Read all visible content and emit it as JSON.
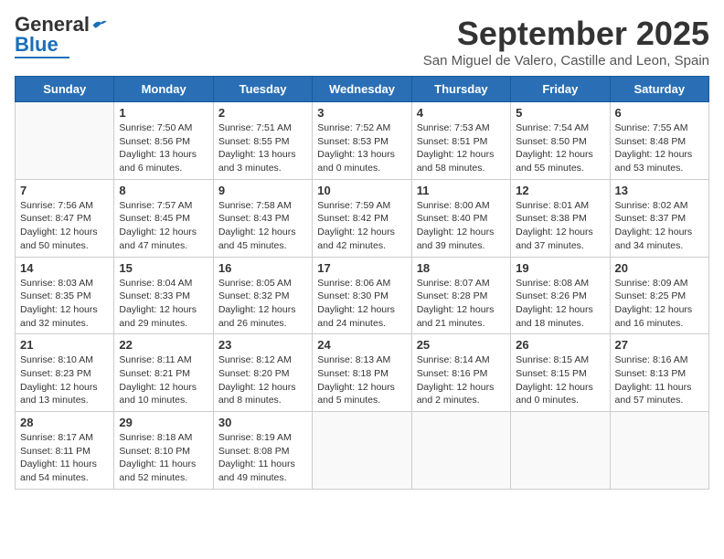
{
  "logo": {
    "general": "General",
    "blue": "Blue"
  },
  "title": "September 2025",
  "subtitle": "San Miguel de Valero, Castille and Leon, Spain",
  "weekdays": [
    "Sunday",
    "Monday",
    "Tuesday",
    "Wednesday",
    "Thursday",
    "Friday",
    "Saturday"
  ],
  "weeks": [
    [
      {
        "day": "",
        "info": ""
      },
      {
        "day": "1",
        "info": "Sunrise: 7:50 AM\nSunset: 8:56 PM\nDaylight: 13 hours\nand 6 minutes."
      },
      {
        "day": "2",
        "info": "Sunrise: 7:51 AM\nSunset: 8:55 PM\nDaylight: 13 hours\nand 3 minutes."
      },
      {
        "day": "3",
        "info": "Sunrise: 7:52 AM\nSunset: 8:53 PM\nDaylight: 13 hours\nand 0 minutes."
      },
      {
        "day": "4",
        "info": "Sunrise: 7:53 AM\nSunset: 8:51 PM\nDaylight: 12 hours\nand 58 minutes."
      },
      {
        "day": "5",
        "info": "Sunrise: 7:54 AM\nSunset: 8:50 PM\nDaylight: 12 hours\nand 55 minutes."
      },
      {
        "day": "6",
        "info": "Sunrise: 7:55 AM\nSunset: 8:48 PM\nDaylight: 12 hours\nand 53 minutes."
      }
    ],
    [
      {
        "day": "7",
        "info": "Sunrise: 7:56 AM\nSunset: 8:47 PM\nDaylight: 12 hours\nand 50 minutes."
      },
      {
        "day": "8",
        "info": "Sunrise: 7:57 AM\nSunset: 8:45 PM\nDaylight: 12 hours\nand 47 minutes."
      },
      {
        "day": "9",
        "info": "Sunrise: 7:58 AM\nSunset: 8:43 PM\nDaylight: 12 hours\nand 45 minutes."
      },
      {
        "day": "10",
        "info": "Sunrise: 7:59 AM\nSunset: 8:42 PM\nDaylight: 12 hours\nand 42 minutes."
      },
      {
        "day": "11",
        "info": "Sunrise: 8:00 AM\nSunset: 8:40 PM\nDaylight: 12 hours\nand 39 minutes."
      },
      {
        "day": "12",
        "info": "Sunrise: 8:01 AM\nSunset: 8:38 PM\nDaylight: 12 hours\nand 37 minutes."
      },
      {
        "day": "13",
        "info": "Sunrise: 8:02 AM\nSunset: 8:37 PM\nDaylight: 12 hours\nand 34 minutes."
      }
    ],
    [
      {
        "day": "14",
        "info": "Sunrise: 8:03 AM\nSunset: 8:35 PM\nDaylight: 12 hours\nand 32 minutes."
      },
      {
        "day": "15",
        "info": "Sunrise: 8:04 AM\nSunset: 8:33 PM\nDaylight: 12 hours\nand 29 minutes."
      },
      {
        "day": "16",
        "info": "Sunrise: 8:05 AM\nSunset: 8:32 PM\nDaylight: 12 hours\nand 26 minutes."
      },
      {
        "day": "17",
        "info": "Sunrise: 8:06 AM\nSunset: 8:30 PM\nDaylight: 12 hours\nand 24 minutes."
      },
      {
        "day": "18",
        "info": "Sunrise: 8:07 AM\nSunset: 8:28 PM\nDaylight: 12 hours\nand 21 minutes."
      },
      {
        "day": "19",
        "info": "Sunrise: 8:08 AM\nSunset: 8:26 PM\nDaylight: 12 hours\nand 18 minutes."
      },
      {
        "day": "20",
        "info": "Sunrise: 8:09 AM\nSunset: 8:25 PM\nDaylight: 12 hours\nand 16 minutes."
      }
    ],
    [
      {
        "day": "21",
        "info": "Sunrise: 8:10 AM\nSunset: 8:23 PM\nDaylight: 12 hours\nand 13 minutes."
      },
      {
        "day": "22",
        "info": "Sunrise: 8:11 AM\nSunset: 8:21 PM\nDaylight: 12 hours\nand 10 minutes."
      },
      {
        "day": "23",
        "info": "Sunrise: 8:12 AM\nSunset: 8:20 PM\nDaylight: 12 hours\nand 8 minutes."
      },
      {
        "day": "24",
        "info": "Sunrise: 8:13 AM\nSunset: 8:18 PM\nDaylight: 12 hours\nand 5 minutes."
      },
      {
        "day": "25",
        "info": "Sunrise: 8:14 AM\nSunset: 8:16 PM\nDaylight: 12 hours\nand 2 minutes."
      },
      {
        "day": "26",
        "info": "Sunrise: 8:15 AM\nSunset: 8:15 PM\nDaylight: 12 hours\nand 0 minutes."
      },
      {
        "day": "27",
        "info": "Sunrise: 8:16 AM\nSunset: 8:13 PM\nDaylight: 11 hours\nand 57 minutes."
      }
    ],
    [
      {
        "day": "28",
        "info": "Sunrise: 8:17 AM\nSunset: 8:11 PM\nDaylight: 11 hours\nand 54 minutes."
      },
      {
        "day": "29",
        "info": "Sunrise: 8:18 AM\nSunset: 8:10 PM\nDaylight: 11 hours\nand 52 minutes."
      },
      {
        "day": "30",
        "info": "Sunrise: 8:19 AM\nSunset: 8:08 PM\nDaylight: 11 hours\nand 49 minutes."
      },
      {
        "day": "",
        "info": ""
      },
      {
        "day": "",
        "info": ""
      },
      {
        "day": "",
        "info": ""
      },
      {
        "day": "",
        "info": ""
      }
    ]
  ]
}
